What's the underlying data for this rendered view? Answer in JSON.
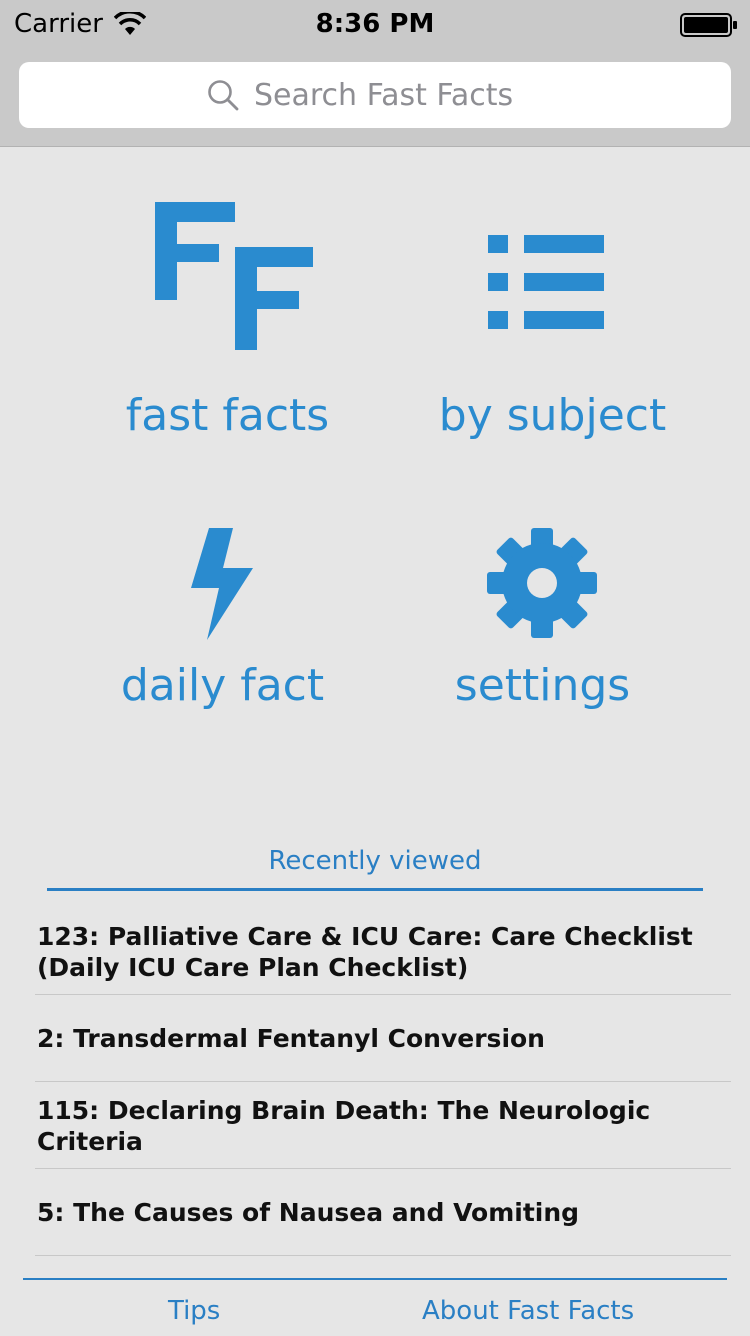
{
  "status_bar": {
    "carrier": "Carrier",
    "time": "8:36 PM"
  },
  "search": {
    "placeholder": "Search Fast Facts",
    "value": ""
  },
  "menu": {
    "fast_facts": {
      "icon_text": "FF",
      "label": "fast facts",
      "icon": "ff-logo-icon"
    },
    "by_subject": {
      "label": "by subject",
      "icon": "list-icon"
    },
    "daily_fact": {
      "label": "daily fact",
      "icon": "lightning-bolt-icon"
    },
    "settings": {
      "label": "settings",
      "icon": "gear-icon"
    }
  },
  "recent": {
    "header": "Recently viewed",
    "items": [
      {
        "title": "123: Palliative Care & ICU Care: Care Checklist (Daily ICU Care Plan Checklist)"
      },
      {
        "title": "2: Transdermal Fentanyl Conversion"
      },
      {
        "title": "115: Declaring Brain Death: The Neurologic Criteria"
      },
      {
        "title": "5: The Causes of Nausea and Vomiting"
      }
    ]
  },
  "footer": {
    "tips": "Tips",
    "about": "About Fast Facts"
  },
  "colors": {
    "accent": "#2a8bcf",
    "background": "#e6e6e6",
    "bar": "#c9c9c9"
  }
}
